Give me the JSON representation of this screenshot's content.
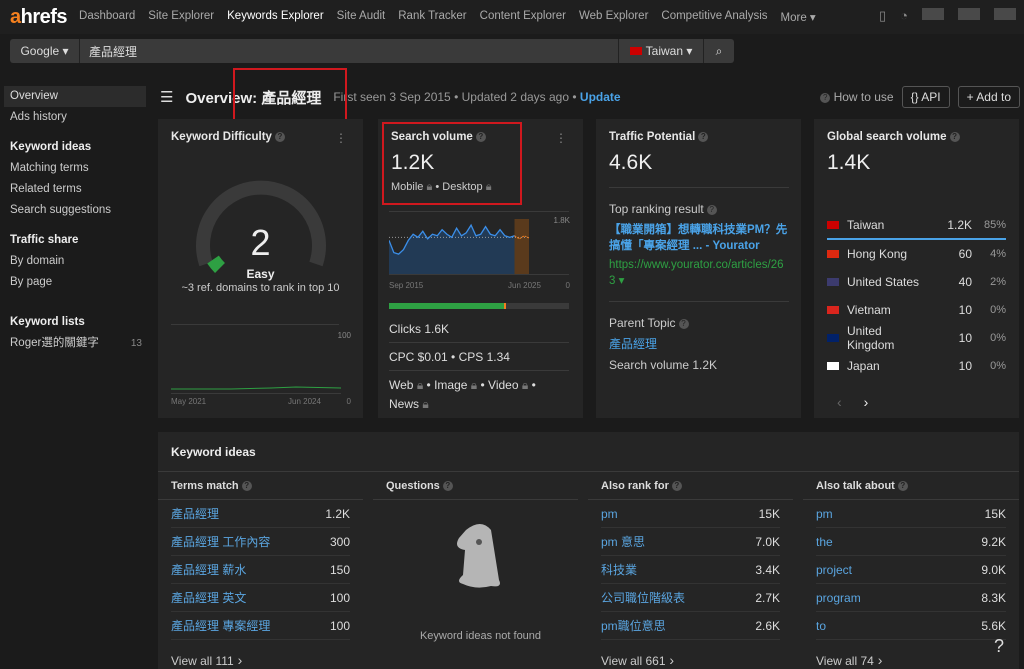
{
  "nav": {
    "logo_a": "a",
    "logo_rest": "hrefs",
    "items": [
      "Dashboard",
      "Site Explorer",
      "Keywords Explorer",
      "Site Audit",
      "Rank Tracker",
      "Content Explorer",
      "Web Explorer",
      "Competitive Analysis",
      "More ▾"
    ],
    "active": "Keywords Explorer"
  },
  "search": {
    "engine": "Google ▾",
    "query": "產品經理",
    "country": "Taiwan ▾"
  },
  "sidebar": {
    "overview": "Overview",
    "ads": "Ads history",
    "ideas_h": "Keyword ideas",
    "matching": "Matching terms",
    "related": "Related terms",
    "suggest": "Search suggestions",
    "traffic_h": "Traffic share",
    "by_domain": "By domain",
    "by_page": "By page",
    "lists_h": "Keyword lists",
    "list1": "Roger選的關鍵字",
    "list1_count": "13"
  },
  "header": {
    "title": "Overview: 產品經理",
    "meta": "First seen 3 Sep 2015 • Updated 2 days ago •",
    "update": "Update",
    "how": "How to use",
    "api": "{} API",
    "add": "+ Add to"
  },
  "kd": {
    "title": "Keyword Difficulty",
    "value": "2",
    "label": "Easy",
    "note": "~3 ref. domains to rank in top 10",
    "ymax": "100",
    "ymin": "0",
    "x_start": "May 2021",
    "x_end": "Jun 2024",
    "difficulty": 2
  },
  "sv": {
    "title": "Search volume",
    "value": "1.2K",
    "mobile": "Mobile",
    "desktop": "Desktop",
    "ymax": "1.8K",
    "ymin": "0",
    "x_start": "Sep 2015",
    "x_end": "Jun 2025",
    "trend": [
      1100,
      700,
      650,
      800,
      1100,
      1300,
      1200,
      1400,
      1150,
      1300,
      1250,
      1450,
      1300,
      1200,
      1500,
      1250,
      1350,
      1600,
      1250,
      1300,
      1550,
      1300,
      1250,
      1450,
      1250,
      1200,
      1250,
      1150,
      1250,
      1180
    ],
    "clicks_share": 0.65,
    "clicks": "Clicks 1.6K",
    "cpc": "CPC $0.01",
    "cps": "CPS 1.34",
    "web": "Web",
    "image": "Image",
    "video": "Video",
    "news": "News"
  },
  "tp": {
    "title": "Traffic Potential",
    "value": "4.6K",
    "top_label": "Top ranking result",
    "top_title": "【職業開箱】想轉職科技業PM？先搞懂「專案經理 ... - Yourator",
    "top_url": "https://www.yourator.co/articles/263 ▾",
    "parent_label": "Parent Topic",
    "parent": "產品經理",
    "parent_sv": "Search volume 1.2K"
  },
  "gsv": {
    "title": "Global search volume",
    "value": "1.4K",
    "countries": [
      {
        "name": "Taiwan",
        "vol": "1.2K",
        "pct": "85%"
      },
      {
        "name": "Hong Kong",
        "vol": "60",
        "pct": "4%"
      },
      {
        "name": "United States",
        "vol": "40",
        "pct": "2%"
      },
      {
        "name": "Vietnam",
        "vol": "10",
        "pct": "0%"
      },
      {
        "name": "United Kingdom",
        "vol": "10",
        "pct": "0%"
      },
      {
        "name": "Japan",
        "vol": "10",
        "pct": "0%"
      }
    ]
  },
  "ideas": {
    "title": "Keyword ideas",
    "terms": {
      "h": "Terms match",
      "rows": [
        [
          "產品經理",
          "1.2K"
        ],
        [
          "產品經理 工作內容",
          "300"
        ],
        [
          "產品經理 薪水",
          "150"
        ],
        [
          "產品經理 英文",
          "100"
        ],
        [
          "產品經理 專案經理",
          "100"
        ]
      ],
      "all": "View all 111"
    },
    "questions": {
      "h": "Questions",
      "empty": "Keyword ideas not found"
    },
    "also_rank": {
      "h": "Also rank for",
      "rows": [
        [
          "pm",
          "15K"
        ],
        [
          "pm 意思",
          "7.0K"
        ],
        [
          "科技業",
          "3.4K"
        ],
        [
          "公司職位階級表",
          "2.7K"
        ],
        [
          "pm職位意思",
          "2.6K"
        ]
      ],
      "all": "View all 661"
    },
    "also_talk": {
      "h": "Also talk about",
      "rows": [
        [
          "pm",
          "15K"
        ],
        [
          "the",
          "9.2K"
        ],
        [
          "project",
          "9.0K"
        ],
        [
          "program",
          "8.3K"
        ],
        [
          "to",
          "5.6K"
        ]
      ],
      "all": "View all 74"
    }
  },
  "help": "?"
}
